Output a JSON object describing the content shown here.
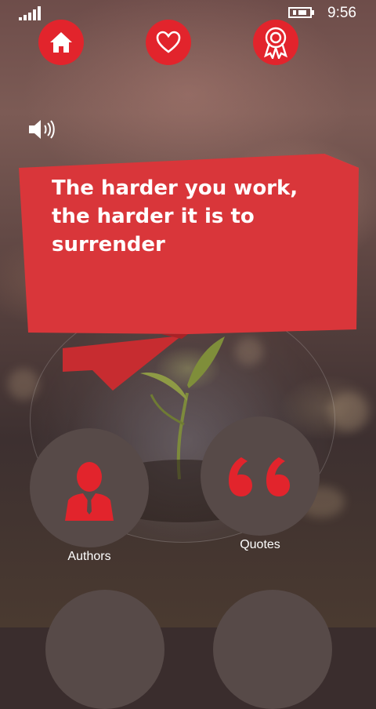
{
  "status_bar": {
    "time": "9:56",
    "signal_icon": "signal-bars-icon",
    "battery_icon": "battery-charging-icon"
  },
  "nav": [
    {
      "name": "home",
      "icon": "home-icon"
    },
    {
      "name": "favorites",
      "icon": "heart-icon"
    },
    {
      "name": "awards",
      "icon": "ribbon-award-icon"
    }
  ],
  "speaker_icon": "speaker-icon",
  "quote": {
    "text": "The harder you work, the harder it is to surrender"
  },
  "tiles": {
    "authors": {
      "label": "Authors",
      "icon": "person-icon"
    },
    "quotes": {
      "label": "Quotes",
      "icon": "quotation-mark-icon"
    }
  },
  "colors": {
    "accent_red": "#e2242c",
    "ribbon_red": "#d9363a",
    "tile_gray": "#574a48"
  }
}
